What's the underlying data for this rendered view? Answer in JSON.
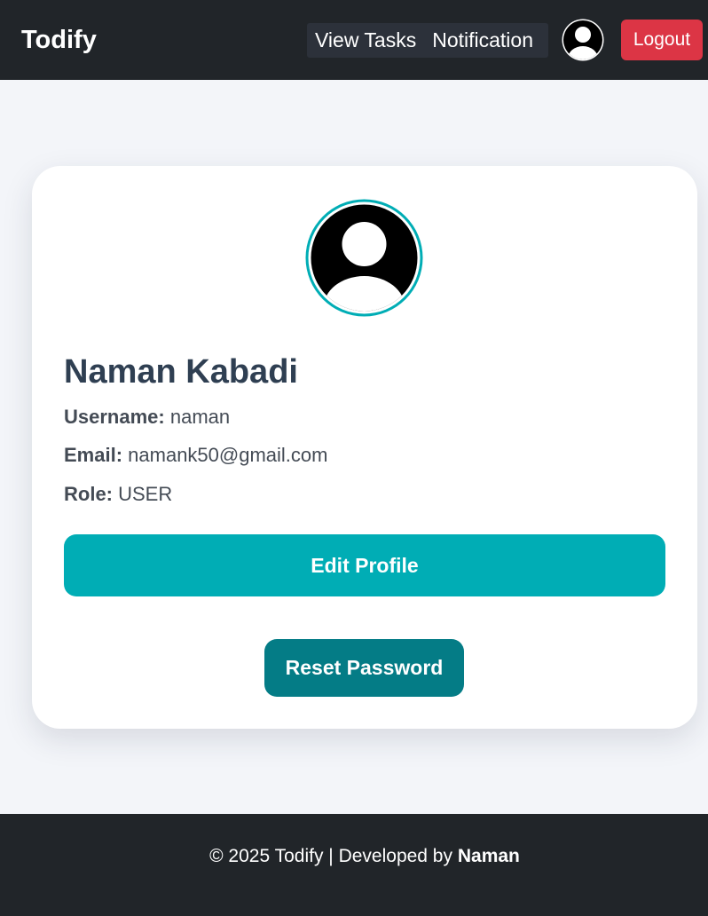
{
  "navbar": {
    "brand": "Todify",
    "links": [
      "View Tasks",
      "Notification"
    ],
    "avatar_icon": "user-avatar-icon",
    "logout_label": "Logout"
  },
  "profile": {
    "avatar_icon": "user-avatar-icon",
    "name": "Naman Kabadi",
    "username_label": "Username:",
    "username": "naman",
    "email_label": "Email:",
    "email": "namank50@gmail.com",
    "role_label": "Role:",
    "role": "USER",
    "edit_label": "Edit Profile",
    "reset_label": "Reset Password"
  },
  "footer": {
    "text": "© 2025 Todify | Developed by",
    "author": "Naman"
  },
  "colors": {
    "navbar_bg": "#212529",
    "accent": "#00adb5",
    "accent_dark": "#047c86",
    "danger": "#dc3545",
    "page_bg": "#f3f5f9"
  }
}
